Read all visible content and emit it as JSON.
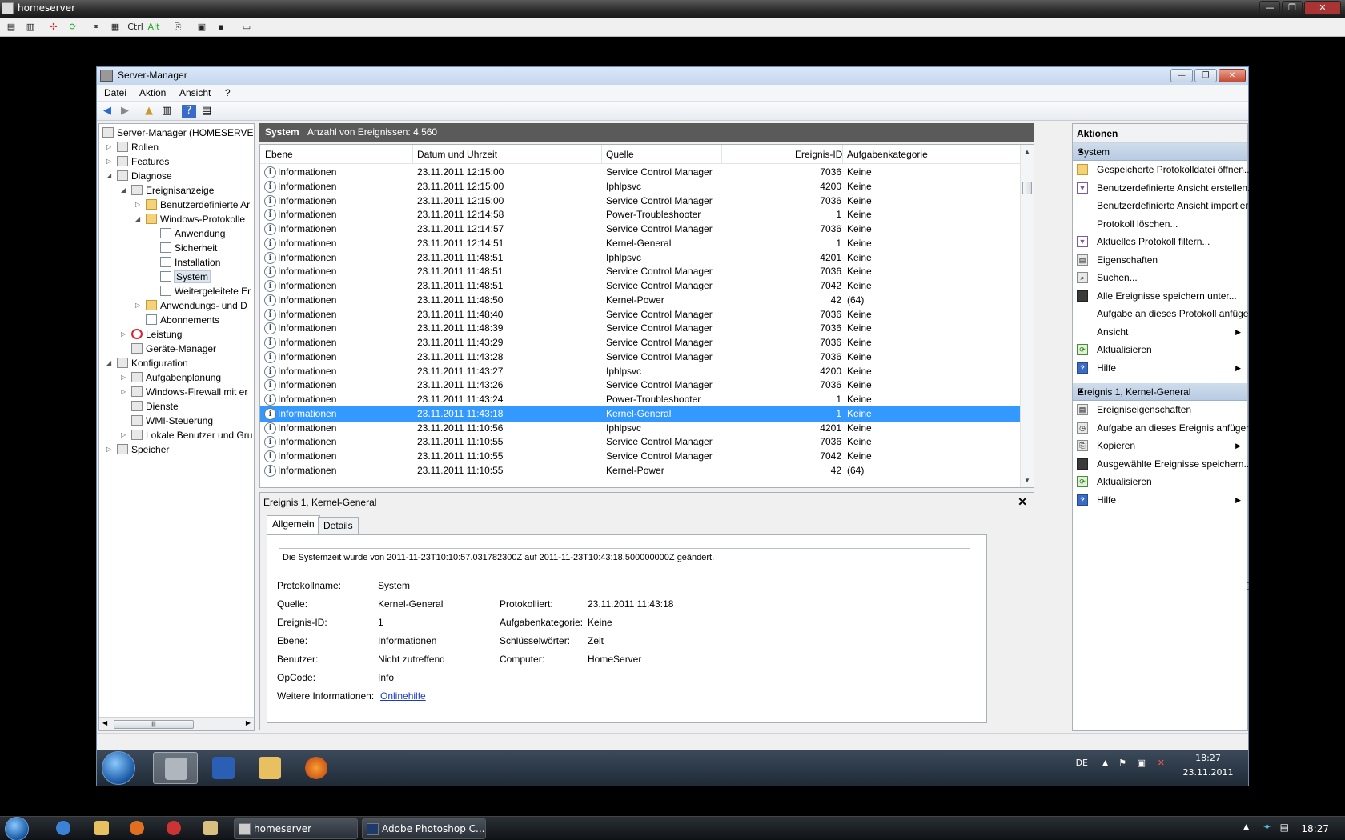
{
  "rd_window": {
    "title": "homeserver",
    "toolbar_icons": [
      "properties-icon",
      "info-icon",
      "fullscreen-icon",
      "refresh-icon",
      "link-icon",
      "users-icon",
      "ctrl-key",
      "alt-key",
      "copy-icon",
      "clipboard-icon",
      "save-icon",
      "window-icon"
    ],
    "ctrl_label": "Ctrl",
    "alt_label": "Alt"
  },
  "sm": {
    "title": "Server-Manager",
    "menu": [
      "Datei",
      "Aktion",
      "Ansicht",
      "?"
    ]
  },
  "tree": {
    "root": "Server-Manager (HOMESERVER)",
    "items": [
      {
        "label": "Rollen",
        "depth": 1,
        "exp": "▷"
      },
      {
        "label": "Features",
        "depth": 1,
        "exp": "▷"
      },
      {
        "label": "Diagnose",
        "depth": 1,
        "exp": "◢"
      },
      {
        "label": "Ereignisanzeige",
        "depth": 2,
        "exp": "◢"
      },
      {
        "label": "Benutzerdefinierte Ar",
        "depth": 3,
        "exp": "▷"
      },
      {
        "label": "Windows-Protokolle",
        "depth": 3,
        "exp": "◢"
      },
      {
        "label": "Anwendung",
        "depth": 4,
        "exp": ""
      },
      {
        "label": "Sicherheit",
        "depth": 4,
        "exp": ""
      },
      {
        "label": "Installation",
        "depth": 4,
        "exp": ""
      },
      {
        "label": "System",
        "depth": 4,
        "exp": "",
        "selected": true
      },
      {
        "label": "Weitergeleitete Er",
        "depth": 4,
        "exp": ""
      },
      {
        "label": "Anwendungs- und D",
        "depth": 3,
        "exp": "▷"
      },
      {
        "label": "Abonnements",
        "depth": 3,
        "exp": ""
      },
      {
        "label": "Leistung",
        "depth": 2,
        "exp": "▷"
      },
      {
        "label": "Geräte-Manager",
        "depth": 2,
        "exp": ""
      },
      {
        "label": "Konfiguration",
        "depth": 1,
        "exp": "◢"
      },
      {
        "label": "Aufgabenplanung",
        "depth": 2,
        "exp": "▷"
      },
      {
        "label": "Windows-Firewall mit er",
        "depth": 2,
        "exp": "▷"
      },
      {
        "label": "Dienste",
        "depth": 2,
        "exp": ""
      },
      {
        "label": "WMI-Steuerung",
        "depth": 2,
        "exp": ""
      },
      {
        "label": "Lokale Benutzer und Gru",
        "depth": 2,
        "exp": "▷"
      },
      {
        "label": "Speicher",
        "depth": 1,
        "exp": "▷"
      }
    ]
  },
  "events": {
    "header_title": "System",
    "header_count": "Anzahl von Ereignissen: 4.560",
    "columns": [
      "Ebene",
      "Datum und Uhrzeit",
      "Quelle",
      "Ereignis-ID",
      "Aufgabenkategorie"
    ],
    "rows": [
      [
        "Informationen",
        "23.11.2011 12:15:00",
        "Service Control Manager",
        "7036",
        "Keine"
      ],
      [
        "Informationen",
        "23.11.2011 12:15:00",
        "Iphlpsvc",
        "4200",
        "Keine"
      ],
      [
        "Informationen",
        "23.11.2011 12:15:00",
        "Service Control Manager",
        "7036",
        "Keine"
      ],
      [
        "Informationen",
        "23.11.2011 12:14:58",
        "Power-Troubleshooter",
        "1",
        "Keine"
      ],
      [
        "Informationen",
        "23.11.2011 12:14:57",
        "Service Control Manager",
        "7036",
        "Keine"
      ],
      [
        "Informationen",
        "23.11.2011 12:14:51",
        "Kernel-General",
        "1",
        "Keine"
      ],
      [
        "Informationen",
        "23.11.2011 11:48:51",
        "Iphlpsvc",
        "4201",
        "Keine"
      ],
      [
        "Informationen",
        "23.11.2011 11:48:51",
        "Service Control Manager",
        "7036",
        "Keine"
      ],
      [
        "Informationen",
        "23.11.2011 11:48:51",
        "Service Control Manager",
        "7042",
        "Keine"
      ],
      [
        "Informationen",
        "23.11.2011 11:48:50",
        "Kernel-Power",
        "42",
        "(64)"
      ],
      [
        "Informationen",
        "23.11.2011 11:48:40",
        "Service Control Manager",
        "7036",
        "Keine"
      ],
      [
        "Informationen",
        "23.11.2011 11:48:39",
        "Service Control Manager",
        "7036",
        "Keine"
      ],
      [
        "Informationen",
        "23.11.2011 11:43:29",
        "Service Control Manager",
        "7036",
        "Keine"
      ],
      [
        "Informationen",
        "23.11.2011 11:43:28",
        "Service Control Manager",
        "7036",
        "Keine"
      ],
      [
        "Informationen",
        "23.11.2011 11:43:27",
        "Iphlpsvc",
        "4200",
        "Keine"
      ],
      [
        "Informationen",
        "23.11.2011 11:43:26",
        "Service Control Manager",
        "7036",
        "Keine"
      ],
      [
        "Informationen",
        "23.11.2011 11:43:24",
        "Power-Troubleshooter",
        "1",
        "Keine"
      ],
      [
        "Informationen",
        "23.11.2011 11:43:18",
        "Kernel-General",
        "1",
        "Keine"
      ],
      [
        "Informationen",
        "23.11.2011 11:10:56",
        "Iphlpsvc",
        "4201",
        "Keine"
      ],
      [
        "Informationen",
        "23.11.2011 11:10:55",
        "Service Control Manager",
        "7036",
        "Keine"
      ],
      [
        "Informationen",
        "23.11.2011 11:10:55",
        "Service Control Manager",
        "7042",
        "Keine"
      ],
      [
        "Informationen",
        "23.11.2011 11:10:55",
        "Kernel-Power",
        "42",
        "(64)"
      ]
    ],
    "selected_index": 17
  },
  "detail": {
    "title": "Ereignis 1, Kernel-General",
    "tabs": [
      "Allgemein",
      "Details"
    ],
    "message": "Die Systemzeit wurde von 2011-11-23T10:10:57.031782300Z auf 2011-11-23T10:43:18.500000000Z geändert.",
    "fields": {
      "protokollname_label": "Protokollname:",
      "protokollname": "System",
      "quelle_label": "Quelle:",
      "quelle": "Kernel-General",
      "protokolliert_label": "Protokolliert:",
      "protokolliert": "23.11.2011 11:43:18",
      "ereignis_id_label": "Ereignis-ID:",
      "ereignis_id": "1",
      "aufgabenkategorie_label": "Aufgabenkategorie:",
      "aufgabenkategorie": "Keine",
      "ebene_label": "Ebene:",
      "ebene": "Informationen",
      "schluesselwoerter_label": "Schlüsselwörter:",
      "schluesselwoerter": "Zeit",
      "benutzer_label": "Benutzer:",
      "benutzer": "Nicht zutreffend",
      "computer_label": "Computer:",
      "computer": "HomeServer",
      "opcode_label": "OpCode:",
      "opcode": "Info",
      "weitere_label": "Weitere Informationen:",
      "weitere_link": "Onlinehilfe"
    }
  },
  "actions": {
    "title": "Aktionen",
    "section1": "System",
    "section1_items": [
      {
        "label": "Gespeicherte Protokolldatei öffnen...",
        "icon": "folder"
      },
      {
        "label": "Benutzerdefinierte Ansicht erstellen...",
        "icon": "filter"
      },
      {
        "label": "Benutzerdefinierte Ansicht importiere...",
        "icon": ""
      },
      {
        "label": "Protokoll löschen...",
        "icon": ""
      },
      {
        "label": "Aktuelles Protokoll filtern...",
        "icon": "filter"
      },
      {
        "label": "Eigenschaften",
        "icon": "props"
      },
      {
        "label": "Suchen...",
        "icon": "find"
      },
      {
        "label": "Alle Ereignisse speichern unter...",
        "icon": "save"
      },
      {
        "label": "Aufgabe an dieses Protokoll anfügen...",
        "icon": ""
      },
      {
        "label": "Ansicht",
        "icon": "",
        "submenu": true
      },
      {
        "label": "Aktualisieren",
        "icon": "green"
      },
      {
        "label": "Hilfe",
        "icon": "help",
        "submenu": true
      }
    ],
    "section2": "Ereignis 1, Kernel-General",
    "section2_items": [
      {
        "label": "Ereigniseigenschaften",
        "icon": "props"
      },
      {
        "label": "Aufgabe an dieses Ereignis anfügen...",
        "icon": "task"
      },
      {
        "label": "Kopieren",
        "icon": "copy",
        "submenu": true
      },
      {
        "label": "Ausgewählte Ereignisse speichern...",
        "icon": "save"
      },
      {
        "label": "Aktualisieren",
        "icon": "green"
      },
      {
        "label": "Hilfe",
        "icon": "help",
        "submenu": true
      }
    ]
  },
  "remote_taskbar": {
    "lang": "DE",
    "time": "18:27",
    "date": "23.11.2011"
  },
  "host_taskbar": {
    "buttons": [
      "homeserver",
      "Adobe Photoshop C..."
    ],
    "time": "18:27"
  }
}
